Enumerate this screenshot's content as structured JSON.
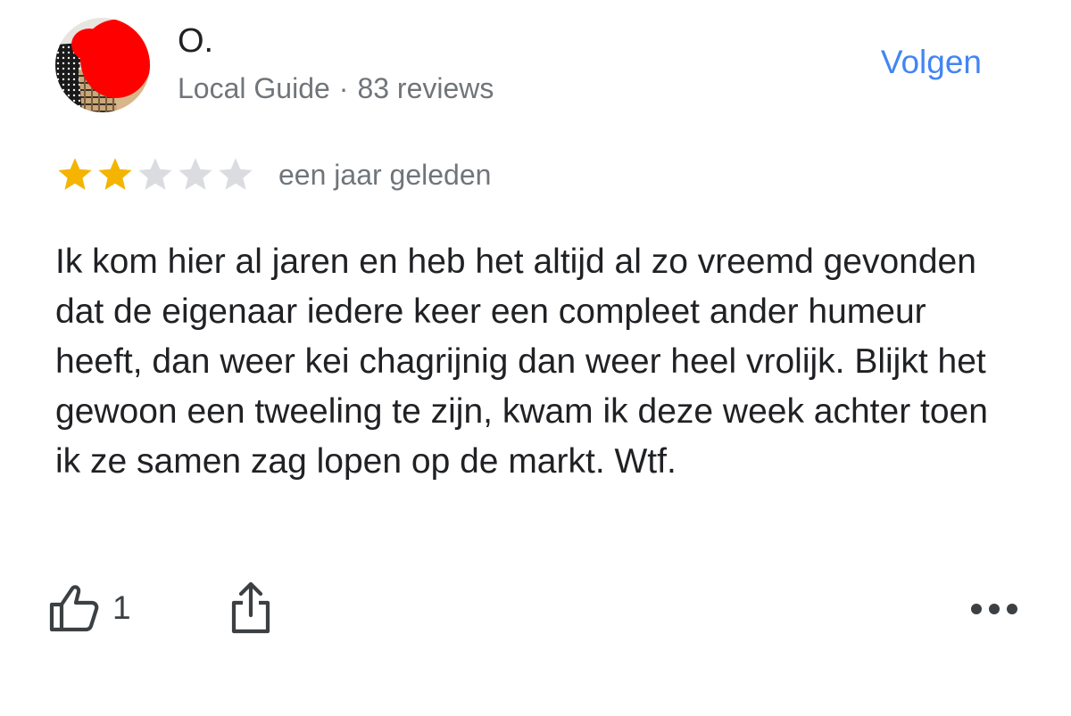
{
  "author": {
    "name": "O.",
    "badge": "Local Guide",
    "separator": "·",
    "review_count": "83 reviews"
  },
  "follow_label": "Volgen",
  "rating": {
    "value": 2,
    "max": 5,
    "filled_color": "#f4b400",
    "empty_color": "#dadce0"
  },
  "date": "een jaar geleden",
  "text": "Ik kom hier al jaren en heb het altijd al zo vreemd gevonden dat de eigenaar iedere keer een compleet ander humeur heeft, dan weer kei chagrijnig dan weer heel vrolijk. Blijkt het gewoon een tweeling te zijn, kwam ik deze week achter toen ik ze samen zag lopen op de markt. Wtf.",
  "actions": {
    "like_count": "1",
    "like_icon": "thumbs-up-icon",
    "share_icon": "share-icon",
    "more_icon": "more-horizontal-icon"
  },
  "colors": {
    "accent": "#4285f4",
    "secondary_text": "#70757a",
    "primary_text": "#202124",
    "avatar_redaction": "#ff0000"
  }
}
